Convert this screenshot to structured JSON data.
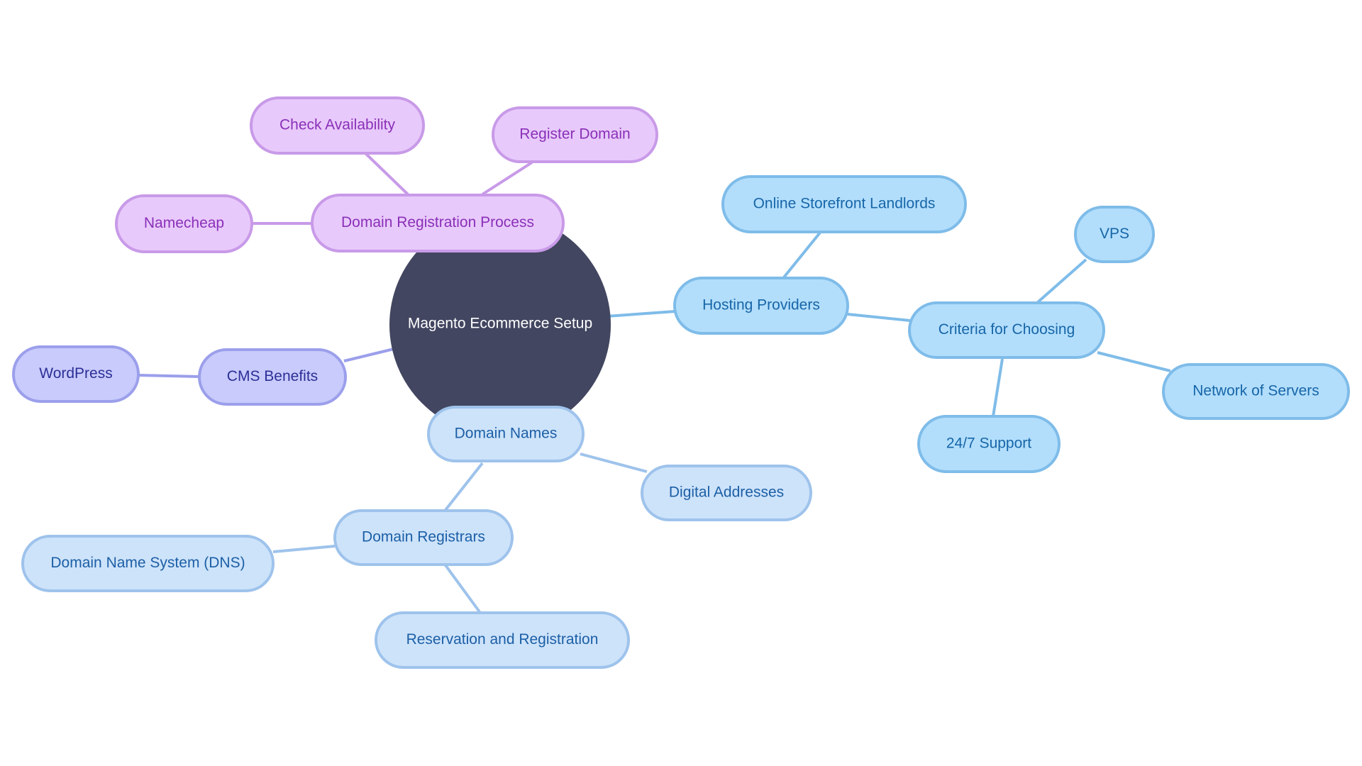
{
  "title": "Magento Ecommerce Setup",
  "palette": {
    "root_fill": "#424660",
    "root_text": "#ffffff",
    "purple": {
      "fill": "#e8c9fb",
      "stroke": "#c89ae8",
      "text": "#8a30b8",
      "edge": "#c89ae8"
    },
    "indigo": {
      "fill": "#c8cbfb",
      "stroke": "#9b9feb",
      "text": "#2c2f96",
      "edge": "#9b9feb"
    },
    "sky": {
      "fill": "#b2defc",
      "stroke": "#7fbce9",
      "text": "#1766a8",
      "edge": "#7fbce9"
    },
    "pale": {
      "fill": "#cde3fa",
      "stroke": "#9ec3ec",
      "text": "#1c5fa6",
      "edge": "#9ec3ec"
    }
  },
  "root": {
    "id": "root",
    "label": "Magento Ecommerce Setup"
  },
  "nodes": [
    {
      "id": "drp",
      "label": "Domain Registration Process",
      "parent": "root",
      "theme": "purple"
    },
    {
      "id": "check",
      "label": "Check Availability",
      "parent": "drp",
      "theme": "purple"
    },
    {
      "id": "register",
      "label": "Register Domain",
      "parent": "drp",
      "theme": "purple"
    },
    {
      "id": "namecheap",
      "label": "Namecheap",
      "parent": "drp",
      "theme": "purple"
    },
    {
      "id": "cms",
      "label": "CMS Benefits",
      "parent": "root",
      "theme": "indigo"
    },
    {
      "id": "wordpress",
      "label": "WordPress",
      "parent": "cms",
      "theme": "indigo"
    },
    {
      "id": "hosting",
      "label": "Hosting Providers",
      "parent": "root",
      "theme": "sky"
    },
    {
      "id": "landlords",
      "label": "Online Storefront Landlords",
      "parent": "hosting",
      "theme": "sky"
    },
    {
      "id": "criteria",
      "label": "Criteria for Choosing",
      "parent": "hosting",
      "theme": "sky"
    },
    {
      "id": "vps",
      "label": "VPS",
      "parent": "criteria",
      "theme": "sky"
    },
    {
      "id": "network",
      "label": "Network of Servers",
      "parent": "criteria",
      "theme": "sky"
    },
    {
      "id": "support",
      "label": "24/7 Support",
      "parent": "criteria",
      "theme": "sky"
    },
    {
      "id": "domains",
      "label": "Domain Names",
      "parent": "root",
      "theme": "pale"
    },
    {
      "id": "digital",
      "label": "Digital Addresses",
      "parent": "domains",
      "theme": "pale"
    },
    {
      "id": "registrars",
      "label": "Domain Registrars",
      "parent": "domains",
      "theme": "pale"
    },
    {
      "id": "dns",
      "label": "Domain Name System (DNS)",
      "parent": "registrars",
      "theme": "pale"
    },
    {
      "id": "reservation",
      "label": "Reservation and Registration",
      "parent": "registrars",
      "theme": "pale"
    }
  ]
}
